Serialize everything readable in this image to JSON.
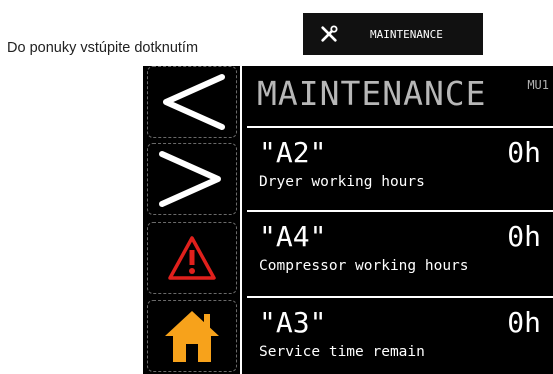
{
  "intro": {
    "text": "Do ponuky vstúpite dotknutím",
    "end_punct": "."
  },
  "menu_button": {
    "icon": "tools-icon",
    "label": "MAINTENANCE"
  },
  "screen": {
    "title": "MAINTENANCE",
    "code": "MU1",
    "sidebar": [
      {
        "icon": "chevron-left-icon",
        "color": "#ffffff"
      },
      {
        "icon": "chevron-right-icon",
        "color": "#ffffff"
      },
      {
        "icon": "warning-icon",
        "color": "#e0201c"
      },
      {
        "icon": "home-icon",
        "color": "#f7a21b"
      }
    ],
    "rows": [
      {
        "code": "\"A2\"",
        "value": "0h",
        "description": "Dryer working hours"
      },
      {
        "code": "\"A4\"",
        "value": "0h",
        "description": "Compressor working hours"
      },
      {
        "code": "\"A3\"",
        "value": "0h",
        "description": "Service time remain"
      }
    ]
  }
}
